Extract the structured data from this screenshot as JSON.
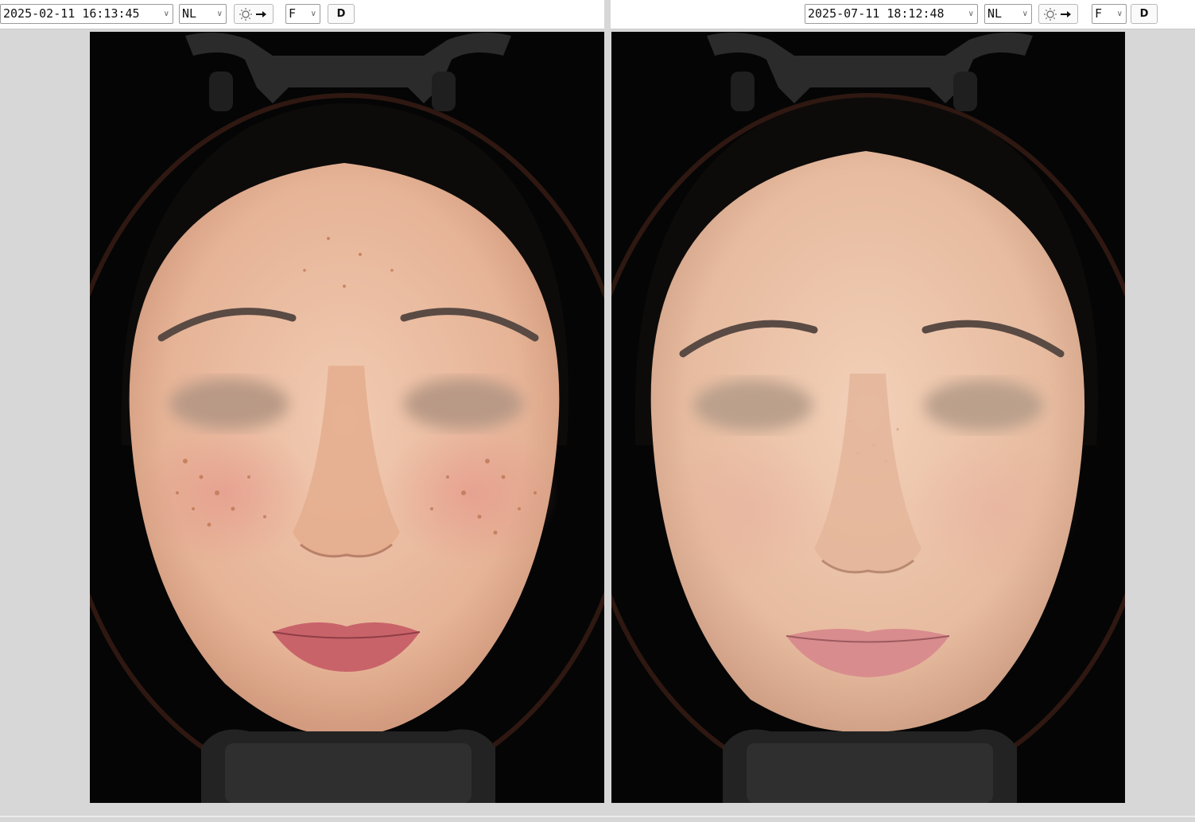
{
  "left_panel": {
    "datetime": "2025-02-11 16:13:45",
    "mode": "NL",
    "light_icon": "sun-arrow-icon",
    "view": "F",
    "d_label": "D",
    "image_alt": "Facial skin analysis photo, front view, earlier capture"
  },
  "right_panel": {
    "datetime": "2025-07-11 18:12:48",
    "mode": "NL",
    "light_icon": "sun-arrow-icon",
    "view": "F",
    "d_label": "D",
    "image_alt": "Facial skin analysis photo, front view, later capture"
  },
  "colors": {
    "background": "#d7d7d7",
    "viewer_bg": "#050505",
    "skin_left": "#e9b79a",
    "skin_right": "#e8bea2"
  }
}
